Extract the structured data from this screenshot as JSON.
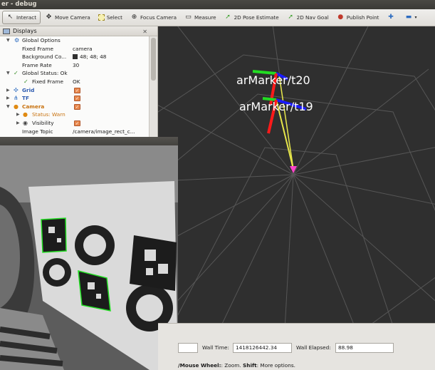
{
  "window": {
    "title": "er - debug"
  },
  "toolbar": {
    "tools": [
      {
        "label": "Interact",
        "icon": "cursor-icon"
      },
      {
        "label": "Move Camera",
        "icon": "move-camera-icon"
      },
      {
        "label": "Select",
        "icon": "select-icon"
      },
      {
        "label": "Focus Camera",
        "icon": "focus-camera-icon"
      },
      {
        "label": "Measure",
        "icon": "ruler-icon"
      },
      {
        "label": "2D Pose Estimate",
        "icon": "pose-arrow-icon"
      },
      {
        "label": "2D Nav Goal",
        "icon": "nav-goal-arrow-icon"
      },
      {
        "label": "Publish Point",
        "icon": "pin-icon"
      }
    ],
    "add_icon": "plus-icon",
    "minus_icon": "minus-icon"
  },
  "displays": {
    "title": "Displays",
    "rows": [
      {
        "label": "Global Options"
      },
      {
        "label": "Fixed Frame",
        "value": "camera"
      },
      {
        "label": "Background Co...",
        "value": "48; 48; 48"
      },
      {
        "label": "Frame Rate",
        "value": "30"
      },
      {
        "label": "Global Status: Ok"
      },
      {
        "label": "Fixed Frame",
        "value": "OK"
      },
      {
        "label": "Grid"
      },
      {
        "label": "TF"
      },
      {
        "label": "Camera"
      },
      {
        "label": "Status: Warn"
      },
      {
        "label": "Visibility"
      },
      {
        "label": "Image Topic",
        "value": "/camera/image_rect_c..."
      }
    ]
  },
  "view3d": {
    "markers": [
      "arMarker/t20",
      "arMarker/t19"
    ],
    "colors": {
      "background": "#2f2f2f",
      "grid": "#5a5a5a",
      "x_axis": "#ff1a1a",
      "y_axis": "#22dd22",
      "z_axis": "#1a1aff",
      "link": "#e6e64a",
      "frame": "#ff44cc"
    }
  },
  "timebar": {
    "wall_time_label": "Wall Time:",
    "wall_time_value": "1418126442.34",
    "wall_elapsed_label": "Wall Elapsed:",
    "wall_elapsed_value": "88.98",
    "hint_prefix": "/Mouse Wheel:",
    "hint_zoom": ": Zoom.",
    "hint_shift": "Shift",
    "hint_more": ": More options."
  }
}
